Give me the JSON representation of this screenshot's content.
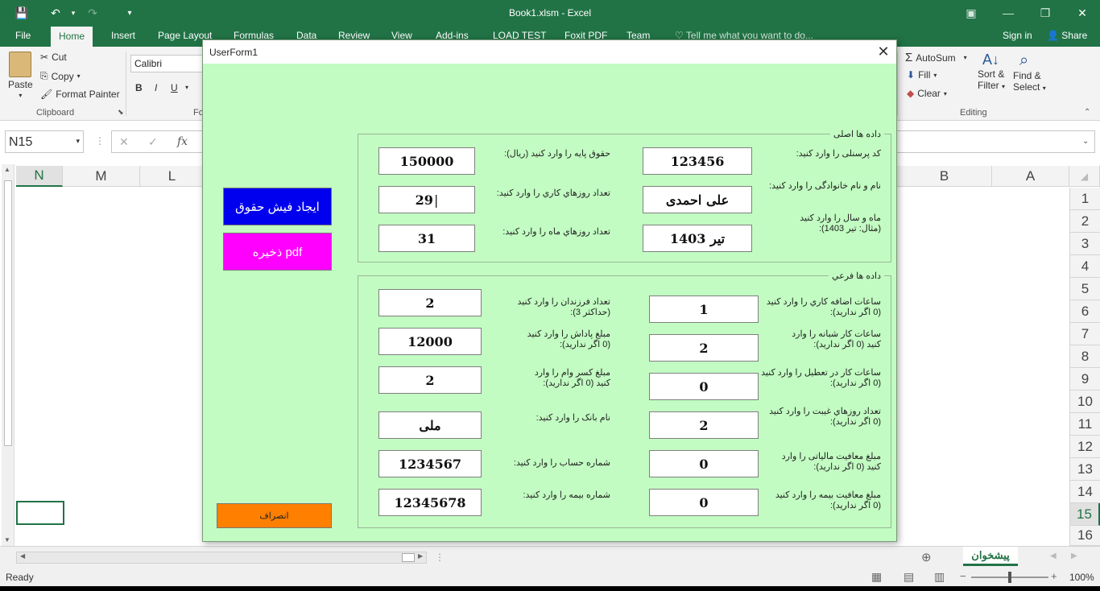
{
  "excel": {
    "file_title": "Book1.xlsm - Excel",
    "qa_save": "💾",
    "qa_undo": "↶",
    "qa_redo": "↷",
    "qa_customize": "▾",
    "win_ribbon": "▣",
    "win_min": "—",
    "win_max": "❐",
    "win_close": "✕",
    "tabs": [
      "File",
      "Home",
      "Insert",
      "Page Layout",
      "Formulas",
      "Data",
      "Review",
      "View",
      "Add-ins",
      "LOAD TEST",
      "Foxit PDF",
      "Team"
    ],
    "tell_me": "Tell me what you want to do...",
    "sign_in": "Sign in",
    "share": "Share",
    "clipboard": {
      "paste": "Paste",
      "cut": "Cut",
      "copy": "Copy",
      "format_painter": "Format Painter",
      "group_label": "Clipboard"
    },
    "font": {
      "name": "Calibri",
      "bold": "B",
      "italic": "I",
      "underline": "U",
      "group_label_partial": "Fo"
    },
    "editing": {
      "autosum": "AutoSum",
      "fill": "Fill",
      "clear": "Clear",
      "sort_filter_1": "Sort &",
      "sort_filter_2": "Filter",
      "find_select_1": "Find &",
      "find_select_2": "Select",
      "group_label": "Editing"
    },
    "name_box": "N15",
    "fx": "fx",
    "columns_left": [
      "N",
      "M",
      "L"
    ],
    "columns_right": [
      "B",
      "A"
    ],
    "rows": [
      "1",
      "2",
      "3",
      "4",
      "5",
      "6",
      "7",
      "8",
      "9",
      "10",
      "11",
      "12",
      "13",
      "14",
      "15",
      "16"
    ],
    "selected_row": "15",
    "sheet_tab": "پیشخوان",
    "status_ready": "Ready",
    "zoom": "100%"
  },
  "userform": {
    "title": "UserForm1",
    "close": "✕",
    "buttons": {
      "create_payslip": "ایجاد فیش حقوق",
      "save_pdf": "ذخیره pdf",
      "cancel": "انصراف"
    },
    "colors": {
      "background": "#c2fcc2",
      "create_payslip_bg": "#0000ee",
      "save_pdf_bg": "#ff00ff",
      "cancel_bg": "#ff7f00"
    },
    "main": {
      "legend": "داده ها اصلی",
      "personnel_code_label": "کد پرسنلی را وارد کنید:",
      "personnel_code": "123456",
      "name_label": "نام و نام خانوادگی را وارد کنید:",
      "name": "علی احمدی",
      "month_year_label_1": "ماه و سال را وارد کنید",
      "month_year_label_2": "(مثال: تیر 1403):",
      "month_year": "1403 تیر",
      "base_salary_label": "حقوق پایه را وارد کنید (ریال):",
      "base_salary": "150000",
      "work_days_label": "تعداد روزهاي كاري را وارد کنید:",
      "work_days": "29",
      "month_days_label": "تعداد روزهاي ماه را وارد کنید:",
      "month_days": "31"
    },
    "sub": {
      "legend": "داده ها فرعي",
      "overtime_label_1": "ساعات اضافه كاري را وارد کنید",
      "overtime_label_2": "(0 اگر ندارید):",
      "overtime": "1",
      "night_label_1": "ساعات كار شبانه را وارد",
      "night_label_2": "کنید (0 اگر ندارید):",
      "night": "2",
      "holiday_label_1": "ساعات كار در تعطیل را وارد کنید",
      "holiday_label_2": "(0 اگر ندارید):",
      "holiday": "0",
      "absence_label_1": "تعداد روزهاي غیبت را وارد کنید",
      "absence_label_2": "(0 اگر ندارید):",
      "absence": "2",
      "tax_exempt_label_1": "مبلغ معافیت مالیاتی را وارد",
      "tax_exempt_label_2": "کنید (0 اگر ندارید):",
      "tax_exempt": "0",
      "ins_exempt_label_1": "مبلغ معافیت بیمه را وارد کنید",
      "ins_exempt_label_2": "(0 اگر ندارید):",
      "ins_exempt": "0",
      "children_label_1": "تعداد فرزندان را وارد کنید",
      "children_label_2": "(حداکثر 3):",
      "children": "2",
      "bonus_label_1": "مبلغ پاداش را وارد کنید",
      "bonus_label_2": "(0 اگر ندارید):",
      "bonus": "12000",
      "loan_label_1": "مبلغ کسر وام را وارد",
      "loan_label_2": "کنید (0 اگر ندارید):",
      "loan": "2",
      "bank_label": "نام بانک را وارد کنید:",
      "bank": "ملی",
      "account_label": "شماره حساب را وارد کنید:",
      "account": "1234567",
      "insurance_label": "شماره بیمه را وارد کنید:",
      "insurance": "12345678"
    }
  }
}
